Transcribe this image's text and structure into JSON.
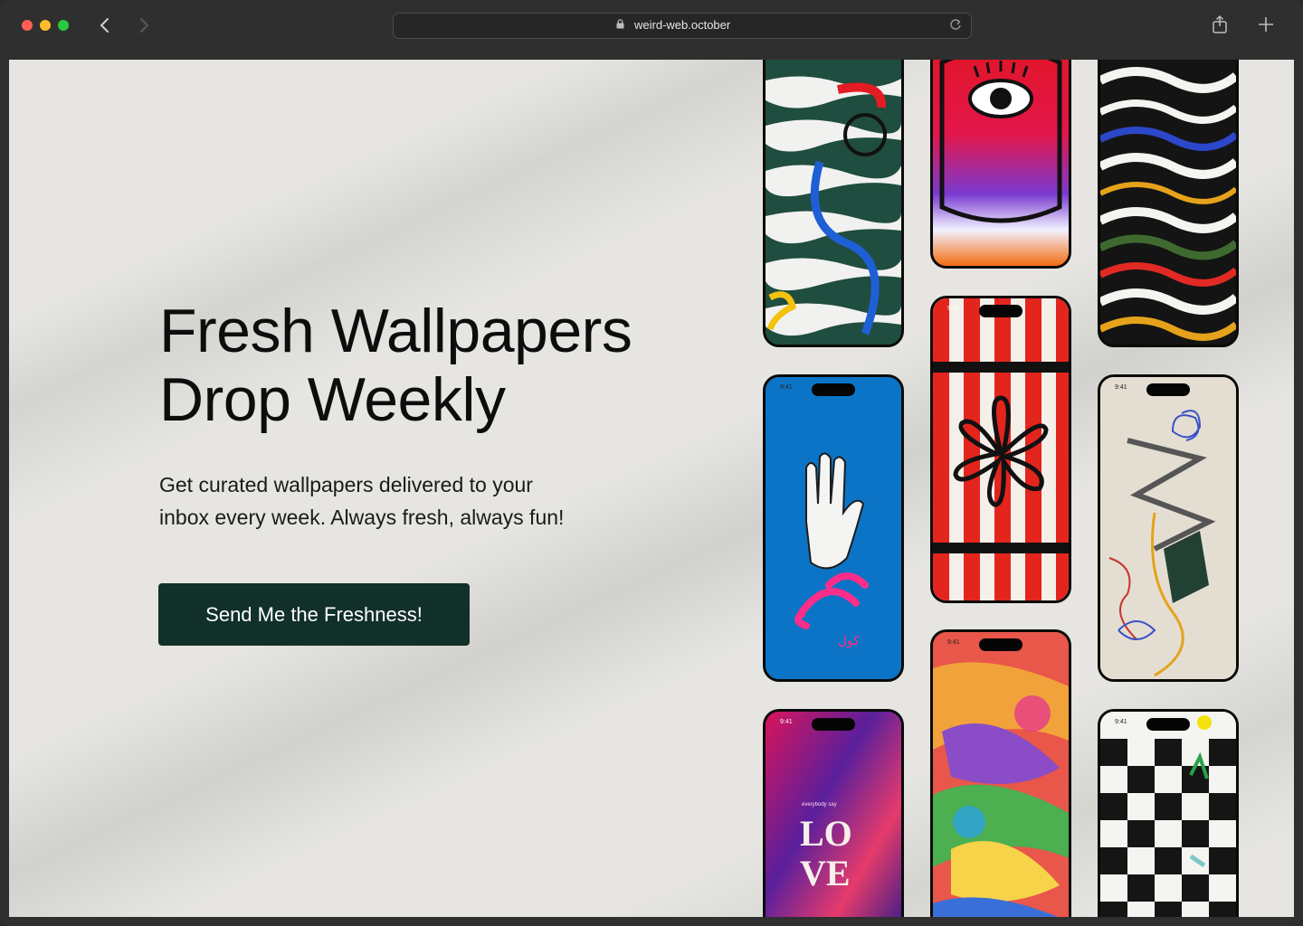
{
  "browser": {
    "url": "weird-web.october",
    "lock_icon": "lock-icon",
    "reload_icon": "reload-icon",
    "back_icon": "chevron-left-icon",
    "forward_icon": "chevron-right-icon",
    "share_icon": "share-icon",
    "new_tab_icon": "plus-icon"
  },
  "hero": {
    "headline_line1": "Fresh Wallpapers",
    "headline_line2": "Drop Weekly",
    "subtext_line1": "Get curated wallpapers delivered to your",
    "subtext_line2": "inbox every week. Always fresh, always fun!",
    "cta_label": "Send Me the Freshness!"
  },
  "wallpapers": {
    "status_time": "9:41",
    "love_caption": "everybody say",
    "love_text_1": "LO",
    "love_text_2": "VE",
    "arabic_text": "كول"
  },
  "colors": {
    "page_bg": "#e6e5e1",
    "cta_bg": "#12302a",
    "headline": "#0d0d0d"
  }
}
